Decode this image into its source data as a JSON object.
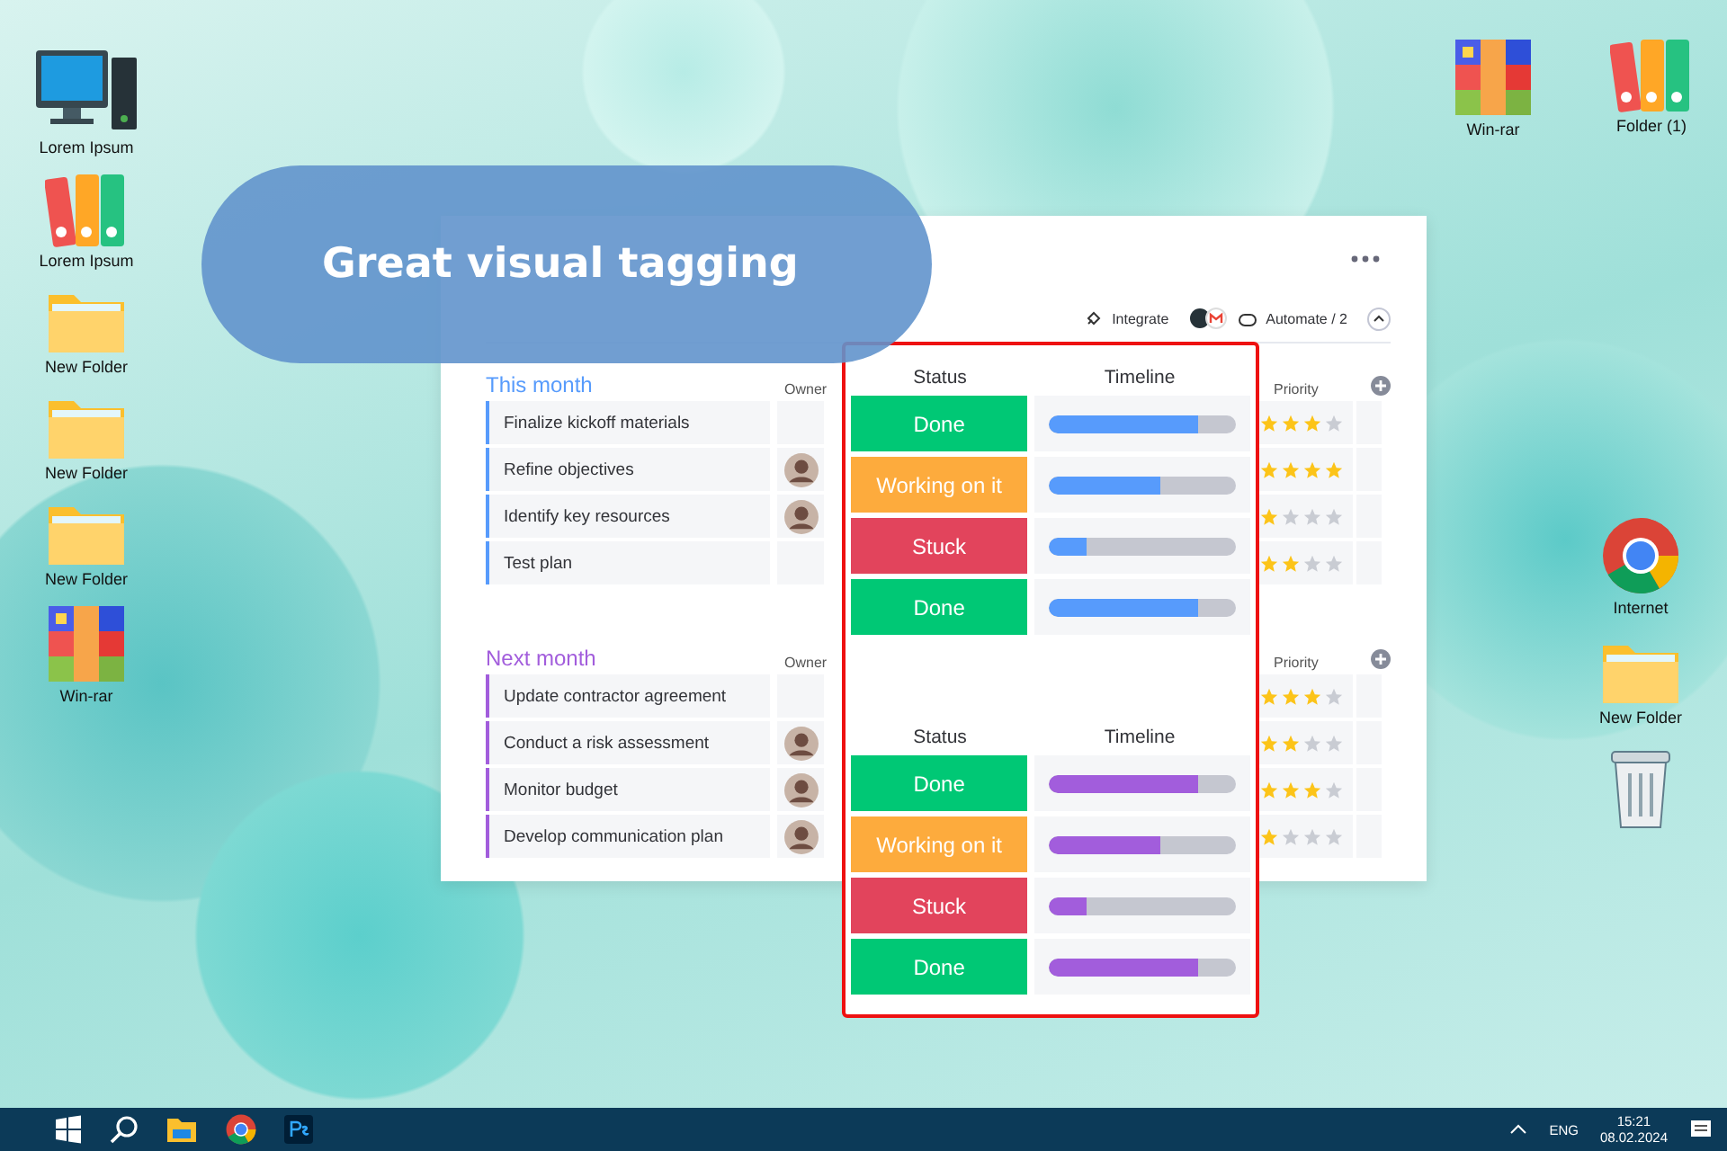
{
  "desktop_left": [
    {
      "kind": "computer",
      "label": "Lorem Ipsum"
    },
    {
      "kind": "binders",
      "label": "Lorem Ipsum"
    },
    {
      "kind": "folder",
      "label": "New Folder"
    },
    {
      "kind": "folder",
      "label": "New Folder"
    },
    {
      "kind": "folder",
      "label": "New Folder"
    },
    {
      "kind": "winrar",
      "label": "Win-rar"
    }
  ],
  "desktop_right_top": [
    {
      "kind": "winrar",
      "label": "Win-rar"
    },
    {
      "kind": "binders",
      "label": "Folder (1)"
    }
  ],
  "desktop_right": [
    {
      "kind": "chrome",
      "label": "Internet"
    },
    {
      "kind": "folder",
      "label": "New Folder"
    },
    {
      "kind": "trash"
    }
  ],
  "banner": {
    "title": "Great visual tagging"
  },
  "board": {
    "integrate": "Integrate",
    "automate": "Automate / 2",
    "groups": [
      {
        "title": "This month",
        "color": "#579bfc",
        "owner_heading": "Owner",
        "priority_heading": "Priority",
        "tasks": [
          {
            "name": "Finalize kickoff materials",
            "avatar": false,
            "stars": 3
          },
          {
            "name": "Refine objectives",
            "avatar": true,
            "stars": 4
          },
          {
            "name": "Identify key resources",
            "avatar": true,
            "stars": 1
          },
          {
            "name": "Test plan",
            "avatar": false,
            "stars": 2
          }
        ]
      },
      {
        "title": "Next month",
        "color": "#a25ddc",
        "owner_heading": "Owner",
        "priority_heading": "Priority",
        "tasks": [
          {
            "name": "Update contractor agreement",
            "avatar": false,
            "stars": 3
          },
          {
            "name": "Conduct a risk assessment",
            "avatar": true,
            "stars": 2
          },
          {
            "name": "Monitor budget",
            "avatar": true,
            "stars": 3
          },
          {
            "name": "Develop communication plan",
            "avatar": true,
            "stars": 1
          }
        ]
      }
    ]
  },
  "tagging": {
    "groups": [
      {
        "status_heading": "Status",
        "timeline_heading": "Timeline",
        "color": "#579bfc",
        "rows": [
          {
            "status": "Done",
            "color": "#00c875",
            "level": 0.8
          },
          {
            "status": "Working on it",
            "color": "#fdab3d",
            "level": 0.6
          },
          {
            "status": "Stuck",
            "color": "#e2445c",
            "level": 0.2
          },
          {
            "status": "Done",
            "color": "#00c875",
            "level": 0.8
          }
        ]
      },
      {
        "status_heading": "Status",
        "timeline_heading": "Timeline",
        "color": "#a25ddc",
        "rows": [
          {
            "status": "Done",
            "color": "#00c875",
            "level": 0.8
          },
          {
            "status": "Working on it",
            "color": "#fdab3d",
            "level": 0.6
          },
          {
            "status": "Stuck",
            "color": "#e2445c",
            "level": 0.2
          },
          {
            "status": "Done",
            "color": "#00c875",
            "level": 0.8
          }
        ]
      }
    ]
  },
  "taskbar": {
    "language": "ENG",
    "time": "15:21",
    "date": "08.02.2024"
  }
}
